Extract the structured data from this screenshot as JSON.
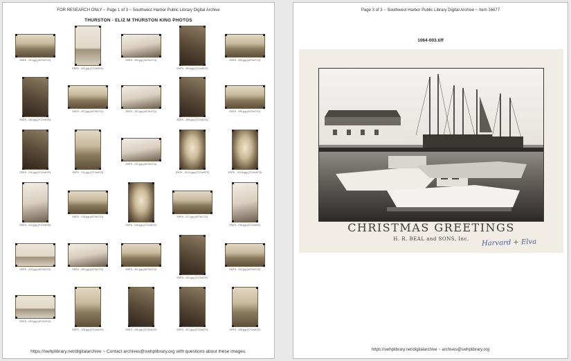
{
  "page1": {
    "header": "FOR RESEARCH ONLY   ~   Page 1 of 3   ~   Southwest Harbor Public Library Digital Archive",
    "title": "THURSTON - ELIZ M THURSTON KING PHOTOS",
    "footer": "https://swhplibrary.net/digitalarchive   ~   Contact archives@swhplibrary.org with questions about these images.",
    "thumbnails": [
      {
        "caption": "EMTK - 001.jpg (4070x2712)",
        "tone": "p-land"
      },
      {
        "caption": "EMTK - 002.jpg (2712x4070)",
        "tone": "p-water"
      },
      {
        "caption": "EMTK - 003.jpg (4070x2712)",
        "tone": "p-snow"
      },
      {
        "caption": "EMTK - 004.jpg (2712x4070)",
        "tone": "p-dark"
      },
      {
        "caption": "EMTK - 005.jpg (4070x2712)",
        "tone": "p-land"
      },
      {
        "caption": "EMTK - 006.jpg (2712x4070)",
        "tone": "p-dark"
      },
      {
        "caption": "EMTK - 007.jpg (4070x2712)",
        "tone": "p-land"
      },
      {
        "caption": "EMTK - 007.jpg (4070x2711)",
        "tone": "p-snow"
      },
      {
        "caption": "EMTK - 008.jpg (2712x4070)",
        "tone": "p-dark"
      },
      {
        "caption": "EMTK - 009.jpg (4070x2712)",
        "tone": "p-land"
      },
      {
        "caption": "EMTK - 010.jpg (2712x4070)",
        "tone": "p-dark"
      },
      {
        "caption": "EMTK - 011.jpg (2712x4070)",
        "tone": "p-land"
      },
      {
        "caption": "EMTK - 012.jpg (4070x2712)",
        "tone": "p-snow"
      },
      {
        "caption": "EMTK - 013 A.jpg (2712x4070)",
        "tone": "p-port"
      },
      {
        "caption": "EMTK - 013 B.jpg (2712x4070)",
        "tone": "p-port"
      },
      {
        "caption": "EMTK - 014.jpg (2712x4070)",
        "tone": "p-snow"
      },
      {
        "caption": "EMTK - 015.jpg (4070x2712)",
        "tone": "p-land"
      },
      {
        "caption": "EMTK - 016.jpg (2712x4070)",
        "tone": "p-port"
      },
      {
        "caption": "EMTK - 017.jpg (4070x2712)",
        "tone": "p-land"
      },
      {
        "caption": "EMTK - 018.jpg (2712x4070)",
        "tone": "p-snow"
      },
      {
        "caption": "EMTK - 019.jpg (4070x2712)",
        "tone": "p-water"
      },
      {
        "caption": "EMTK - 020.jpg (4070x2712)",
        "tone": "p-snow"
      },
      {
        "caption": "EMTK - 021.jpg (4070x2712)",
        "tone": "p-land"
      },
      {
        "caption": "EMTK - 022.jpg (2712x4070)",
        "tone": "p-dark"
      },
      {
        "caption": "EMTK - 023.jpg (4070x2712)",
        "tone": "p-land"
      },
      {
        "caption": "EMTK - 024.jpg (4070x2712)",
        "tone": "p-water"
      },
      {
        "caption": "EMTK - 025.jpg (2712x4070)",
        "tone": "p-land"
      },
      {
        "caption": "EMTK - 026.jpg (2712x4070)",
        "tone": "p-dark"
      },
      {
        "caption": "EMTK - 027.jpg (2712x4070)",
        "tone": "p-dark"
      },
      {
        "caption": "EMTK - 028.jpg (2712x4070)",
        "tone": "p-land"
      }
    ]
  },
  "page2": {
    "header": "Page 3 of 3   ~   Southwest Harbor Public Library Digital Archive   ~   Item 16677",
    "filename": "1064-003.tiff",
    "card": {
      "greeting": "CHRISTMAS GREETINGS",
      "company": "H. R. BEAL and SONS, Inc.",
      "inscription": "Harvard + Elva"
    },
    "footer": "https://swhplibrary.net/digitalarchive   ~   archives@swhplibrary.org"
  }
}
